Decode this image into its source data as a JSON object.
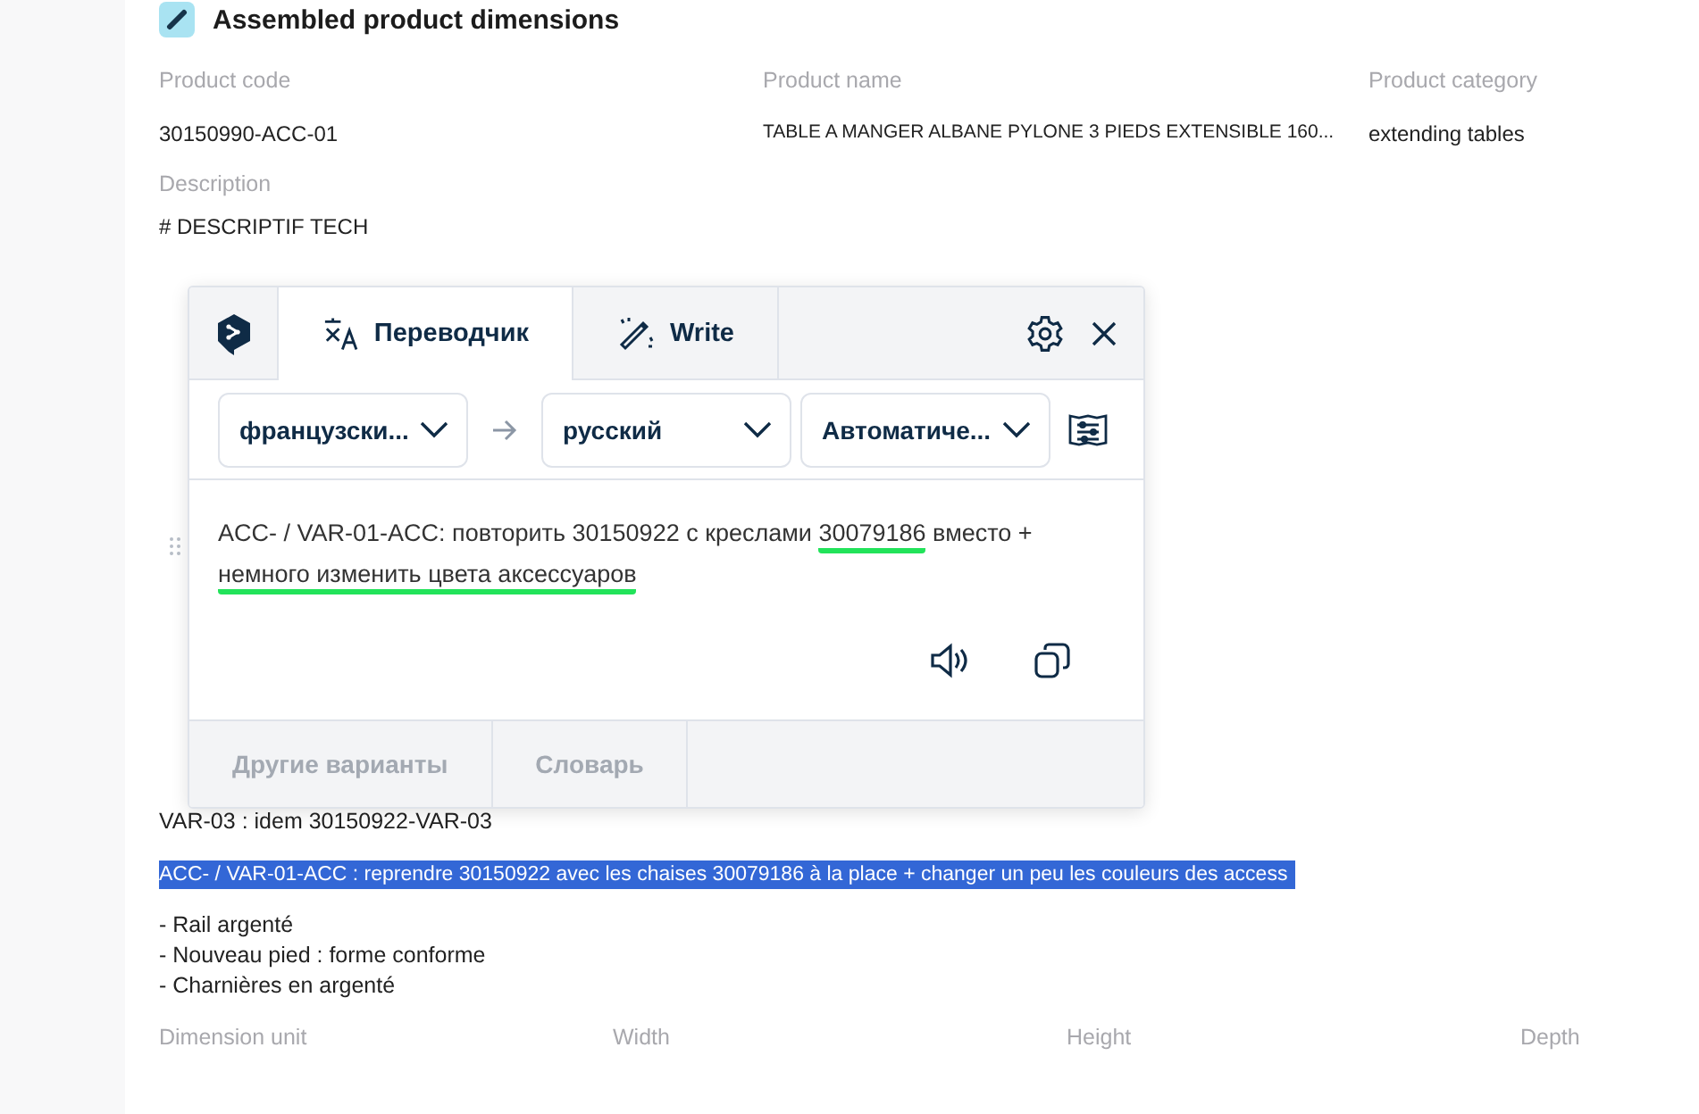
{
  "section": {
    "title": "Assembled product dimensions",
    "fields": [
      {
        "label": "Product code",
        "value": "30150990-ACC-01"
      },
      {
        "label": "Product name",
        "value": "TABLE A MANGER ALBANE PYLONE 3 PIEDS EXTENSIBLE 160..."
      },
      {
        "label": "Product category",
        "value": "extending tables"
      }
    ],
    "description": {
      "label": "Description",
      "heading": "# DESCRIPTIF TECH"
    },
    "description_lines": [
      {
        "text": "VAR-03 : idem 30150922-VAR-03",
        "selected": false
      },
      {
        "text": "ACC- / VAR-01-ACC : reprendre 30150922 avec les chaises 30079186 à la place + changer un peu les couleurs des access",
        "selected": true
      }
    ],
    "list_items": [
      "- Rail argenté",
      "- Nouveau pied : forme conforme",
      "- Charnières en argenté"
    ],
    "dimension_columns": [
      "Dimension unit",
      "Width",
      "Height",
      "Depth"
    ]
  },
  "translator": {
    "tabs": [
      {
        "label": "Переводчик",
        "kind": "translate",
        "selected": true
      },
      {
        "label": "Write",
        "kind": "write",
        "selected": false
      }
    ],
    "selects": [
      {
        "value": "французски...",
        "kind": "source"
      },
      {
        "value": "русский",
        "kind": "target"
      },
      {
        "value": "Автоматиче...",
        "kind": "formality"
      }
    ],
    "translation": [
      {
        "text": "ACC- / VAR-01-ACC: повторить 30150922 с креслами ",
        "underlined": false
      },
      {
        "text": "30079186",
        "underlined": true
      },
      {
        "text": " вместо + ",
        "underlined": false
      },
      {
        "text": "немного изменить цвета аксессуаров",
        "underlined": true
      }
    ],
    "footer_buttons": [
      {
        "label": "Другие варианты",
        "disabled": true
      },
      {
        "label": "Словарь",
        "disabled": true
      }
    ]
  }
}
